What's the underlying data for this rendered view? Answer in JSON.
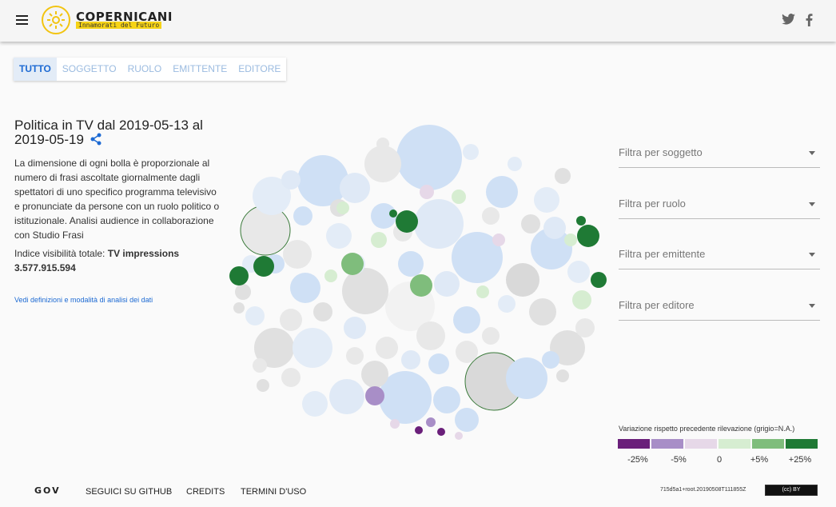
{
  "header": {
    "logo_title": "COPERNICANI",
    "logo_subtitle": "Innamorati del Futuro",
    "icons": [
      "menu-icon",
      "twitter-icon",
      "facebook-icon"
    ]
  },
  "tabs": [
    {
      "label": "TUTTO",
      "active": true
    },
    {
      "label": "SOGGETTO",
      "active": false
    },
    {
      "label": "RUOLO",
      "active": false
    },
    {
      "label": "EMITTENTE",
      "active": false
    },
    {
      "label": "EDITORE",
      "active": false
    }
  ],
  "main": {
    "title": "Politica in TV dal 2019-05-13 al 2019-05-19",
    "description": "La dimensione di ogni bolla è proporzionale al numero di frasi ascoltate giornalmente dagli spettatori di uno specifico programma televisivo e pronunciate da persone con un ruolo politico o istituzionale. Analisi audience in collaborazione con Studio Frasi",
    "visibility_label": "Indice visibilità totale: ",
    "visibility_value_label": "TV impressions",
    "visibility_value": "3.577.915.594",
    "definitions_link": "Vedi definizioni e modalità di analisi dei dati"
  },
  "filters": [
    {
      "placeholder": "Filtra per soggetto"
    },
    {
      "placeholder": "Filtra per ruolo"
    },
    {
      "placeholder": "Filtra per emittente"
    },
    {
      "placeholder": "Filtra per editore"
    }
  ],
  "legend": {
    "title": "Variazione rispetto precedente rilevazione (grigio=N.A.)",
    "colors": [
      "#6a1f7a",
      "#a88ec7",
      "#e6d8e8",
      "#d6edd1",
      "#7fbd7c",
      "#1f7a35"
    ],
    "labels": [
      "-25%",
      "-5%",
      "0",
      "+5%",
      "+25%"
    ]
  },
  "footer": {
    "gov_logo": "GOV",
    "links": [
      "SEGUICI SU GITHUB",
      "CREDITS",
      "TERMINI D'USO"
    ],
    "version": "715d5a1+root.20190508T111855Z",
    "license": "(cc) BY"
  }
}
